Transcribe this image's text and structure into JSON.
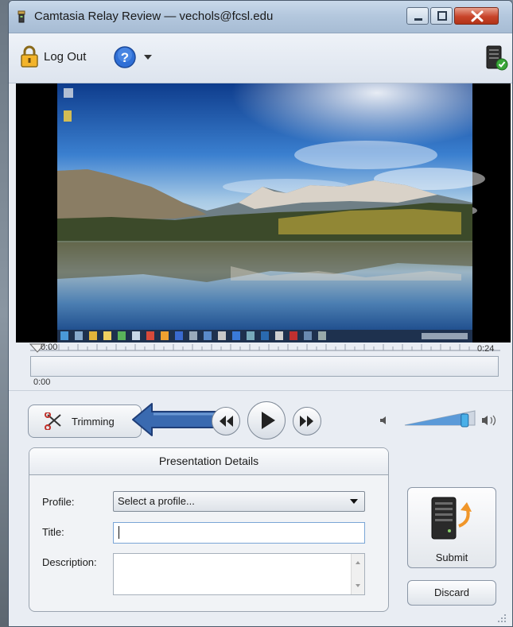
{
  "window": {
    "title": "Camtasia Relay Review — vechols@fcsl.edu"
  },
  "toolbar": {
    "logout_label": "Log Out",
    "help_icon": "help-icon",
    "status_icon": "server-status-icon"
  },
  "player": {
    "time_start": "0:00",
    "time_end": "0:24",
    "current_time": "0:00",
    "trim_label": "Trimming",
    "volume_level": 0.85
  },
  "details": {
    "title": "Presentation Details",
    "profile_label": "Profile:",
    "profile_value": "Select a profile...",
    "title_label": "Title:",
    "title_value": "",
    "description_label": "Description:",
    "description_value": ""
  },
  "actions": {
    "submit_label": "Submit",
    "discard_label": "Discard"
  },
  "colors": {
    "accent_arrow": "#3a6ab0",
    "play_button_rim": "#7d8896",
    "submit_arrow": "#f0962a"
  }
}
